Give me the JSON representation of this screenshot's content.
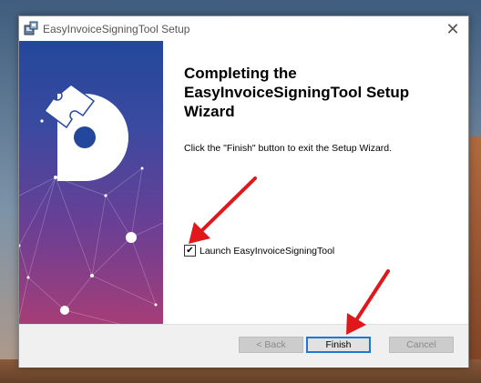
{
  "window": {
    "title": "EasyInvoiceSigningTool Setup"
  },
  "content": {
    "heading_line1": "Completing the",
    "heading_line2": "EasyInvoiceSigningTool Setup",
    "heading_line3": "Wizard",
    "description": "Click the \"Finish\" button to exit the Setup Wizard.",
    "launch_checkbox_label": "Launch EasyInvoiceSigningTool",
    "launch_checked": true
  },
  "buttons": {
    "back": "< Back",
    "finish": "Finish",
    "cancel": "Cancel"
  },
  "icons": {
    "close": "close-icon",
    "app": "installer-icon",
    "checkmark": "checkmark-icon"
  },
  "colors": {
    "annotation_arrow": "#e0181b",
    "finish_focus_border": "#1f77d4",
    "banner_top": "#23479b",
    "banner_bottom": "#a53d77"
  }
}
